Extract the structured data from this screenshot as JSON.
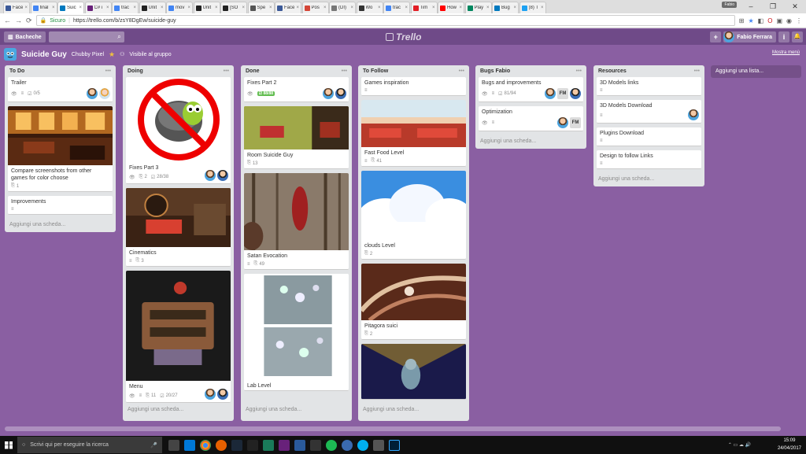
{
  "browser": {
    "tabs": [
      {
        "title": "Face",
        "color": "#3b5998"
      },
      {
        "title": "final",
        "color": "#4285f4"
      },
      {
        "title": "Suic",
        "color": "#0079bf",
        "active": true
      },
      {
        "title": "C# i",
        "color": "#68217a"
      },
      {
        "title": "trac",
        "color": "#4285f4"
      },
      {
        "title": "Unit",
        "color": "#222222"
      },
      {
        "title": "mov",
        "color": "#4285f4"
      },
      {
        "title": "Unit",
        "color": "#222222"
      },
      {
        "title": "[SO",
        "color": "#222222"
      },
      {
        "title": "Spe",
        "color": "#555555"
      },
      {
        "title": "Face",
        "color": "#3b5998"
      },
      {
        "title": "Pos",
        "color": "#d44638"
      },
      {
        "title": "(DI)",
        "color": "#777777"
      },
      {
        "title": "Wo",
        "color": "#333333"
      },
      {
        "title": "trac",
        "color": "#4285f4"
      },
      {
        "title": "Tim",
        "color": "#e21e26"
      },
      {
        "title": "How",
        "color": "#ff0000"
      },
      {
        "title": "Play",
        "color": "#01875f"
      },
      {
        "title": "Bug",
        "color": "#0079bf"
      },
      {
        "title": "(8) T",
        "color": "#1da1f2"
      }
    ],
    "tab_close": "×",
    "window_user": "Fabio",
    "secure_label": "Sicuro",
    "url": "https://trello.com/b/zsY8DgEw/suicide-guy",
    "win_min": "–",
    "win_max": "❐",
    "win_close": "✕"
  },
  "header": {
    "boards_label": "Bacheche",
    "logo": "Trello",
    "user_name": "Fabio Ferrara",
    "add": "+",
    "info": "i",
    "bell": "🔔"
  },
  "board": {
    "name": "Suicide Guy",
    "team": "Chubby Pixel",
    "visibility": "Visibile al gruppo",
    "show_menu": "Mostra menù",
    "add_list": "Aggiungi una lista..."
  },
  "add_card_label": "Aggiungi una scheda...",
  "lists": [
    {
      "name": "To Do",
      "cards": [
        {
          "title": "Trailer",
          "checklist": "0/5"
        },
        {
          "title": "Compare screenshots from other games for color choose",
          "attachments": "1"
        },
        {
          "title": "Improvements"
        }
      ]
    },
    {
      "name": "Doing",
      "cards": [
        {
          "title": "Fixes Part 3",
          "attachments": "2",
          "checklist": "28/38"
        },
        {
          "title": "Cinematics",
          "attachments": "3"
        },
        {
          "title": "Menu",
          "attachments": "11",
          "checklist": "20/27"
        }
      ]
    },
    {
      "name": "Done",
      "cards": [
        {
          "title": "Fixes Part 2",
          "checklist": "88/88"
        },
        {
          "title": "Room Suicide Guy",
          "attachments": "13"
        },
        {
          "title": "Satan Evocation",
          "attachments": "49"
        },
        {
          "title": "Lab Level"
        }
      ]
    },
    {
      "name": "To Follow",
      "cards": [
        {
          "title": "Games inspiration"
        },
        {
          "title": "Fast Food Level",
          "attachments": "41"
        },
        {
          "title": "clouds Level",
          "attachments": "2"
        },
        {
          "title": "Pitagora suici",
          "attachments": "2"
        }
      ]
    },
    {
      "name": "Bugs Fabio",
      "cards": [
        {
          "title": "Bugs and improvements",
          "checklist": "81/94"
        },
        {
          "title": "Optimization"
        }
      ]
    },
    {
      "name": "Resources",
      "cards": [
        {
          "title": "3D Models links"
        },
        {
          "title": "3D Models Download"
        },
        {
          "title": "Plugins Download"
        },
        {
          "title": "Design to follow Links"
        }
      ]
    }
  ],
  "taskbar": {
    "search_placeholder": "Scrivi qui per eseguire la ricerca",
    "time": "15:09",
    "date": "24/04/2017"
  },
  "avatar_initials": "FM"
}
